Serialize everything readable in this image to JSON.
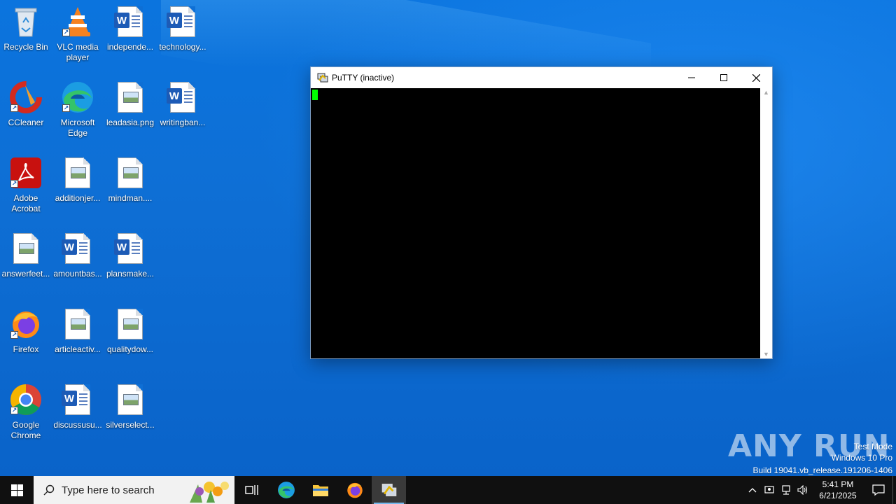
{
  "desktop_icons": [
    {
      "label": "Recycle Bin",
      "type": "recycle"
    },
    {
      "label": "VLC media player",
      "type": "vlc"
    },
    {
      "label": "independe...",
      "type": "word"
    },
    {
      "label": "technology...",
      "type": "word"
    },
    {
      "label": "CCleaner",
      "type": "ccleaner"
    },
    {
      "label": "Microsoft Edge",
      "type": "edge"
    },
    {
      "label": "leadasia.png",
      "type": "image"
    },
    {
      "label": "writingban...",
      "type": "word"
    },
    {
      "label": "Adobe Acrobat",
      "type": "acrobat"
    },
    {
      "label": "additionjer...",
      "type": "image"
    },
    {
      "label": "mindman....",
      "type": "image"
    },
    {
      "label": "answerfeet...",
      "type": "image"
    },
    {
      "label": "amountbas...",
      "type": "word"
    },
    {
      "label": "plansmake...",
      "type": "word"
    },
    {
      "label": "Firefox",
      "type": "firefox"
    },
    {
      "label": "articleactiv...",
      "type": "image"
    },
    {
      "label": "qualitydow...",
      "type": "image"
    },
    {
      "label": "Google Chrome",
      "type": "chrome"
    },
    {
      "label": "discussusu...",
      "type": "word"
    },
    {
      "label": "silverselect...",
      "type": "image"
    }
  ],
  "putty": {
    "title": "PuTTY (inactive)",
    "minimize_icon": "minimize-icon",
    "maximize_icon": "maximize-icon",
    "close_icon": "close-icon",
    "cursor_color": "#00ff00"
  },
  "watermark": {
    "brand": "ANY RUN",
    "line1": "Test Mode",
    "line2": "Windows 10 Pro",
    "line3": "Build 19041.vb_release.191206-1406"
  },
  "taskbar": {
    "search_placeholder": "Type here to search",
    "pinned": [
      "task-view",
      "edge",
      "file-explorer",
      "firefox",
      "putty"
    ],
    "active": "putty",
    "time": "5:41 PM",
    "date": "6/21/2025"
  },
  "colors": {
    "desktop": "#0b74de",
    "taskbar": "#101010",
    "terminal": "#000000"
  }
}
